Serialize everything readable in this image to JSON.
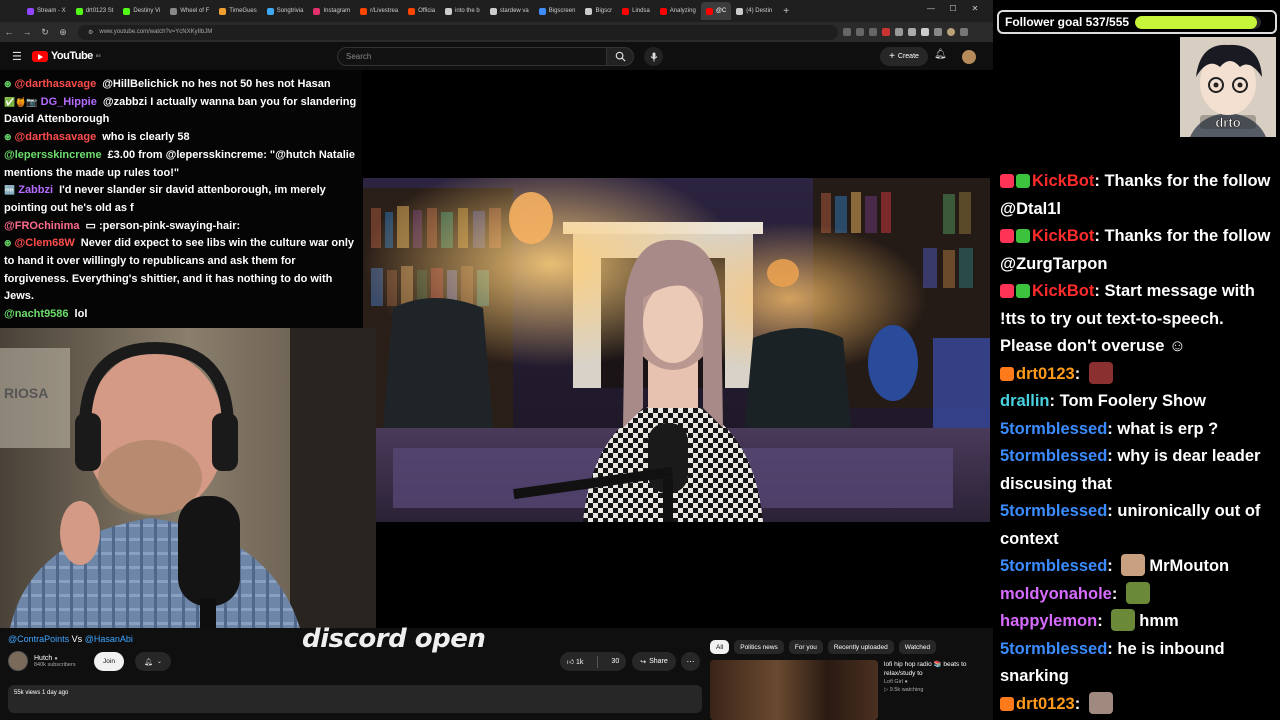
{
  "browser": {
    "tabs": [
      {
        "label": "Stream - X",
        "color": "#9146ff"
      },
      {
        "label": "drt0123 St",
        "color": "#53fc18"
      },
      {
        "label": "Destiny Vi",
        "color": "#53fc18"
      },
      {
        "label": "Wheel of F",
        "color": "#888888"
      },
      {
        "label": "TimeGues",
        "color": "#f0a030"
      },
      {
        "label": "Songtrivia",
        "color": "#3fa9f5"
      },
      {
        "label": "Instagram",
        "color": "#e1306c"
      },
      {
        "label": "r/Livestrea",
        "color": "#ff4500"
      },
      {
        "label": "Officia",
        "color": "#ff4500"
      },
      {
        "label": "into the b",
        "color": "#cccccc"
      },
      {
        "label": "stardew va",
        "color": "#cccccc"
      },
      {
        "label": "Bigscreen",
        "color": "#3f8cff"
      },
      {
        "label": "Bigscr",
        "color": "#cccccc"
      },
      {
        "label": "Lindsa",
        "color": "#ff0000"
      },
      {
        "label": "Analyzing",
        "color": "#ff0000"
      },
      {
        "label": "@C",
        "color": "#ff0000",
        "active": true
      },
      {
        "label": "(4) Destin",
        "color": "#cccccc"
      }
    ],
    "url": "www.youtube.com/watch?v=YcNXKyIIbJM"
  },
  "youtube": {
    "logo_text": "YouTube",
    "logo_sup": "BE",
    "search_placeholder": "Search",
    "create_label": "Create"
  },
  "left_chat": [
    {
      "user": "@darthasavage",
      "color": "#ff4d4d",
      "badges": "⊛",
      "text": "@HillBelichick no hes not 50 hes not Hasan"
    },
    {
      "user": "DG_Hippie",
      "color": "#b56bff",
      "badges": "✅🍯📷",
      "text": "@zabbzi I actually wanna ban you for slandering David Attenborough"
    },
    {
      "user": "@darthasavage",
      "color": "#ff4d4d",
      "badges": "⊛",
      "text": "who is clearly 58"
    },
    {
      "user": "@lepersskincreme",
      "color": "#6dde6d",
      "badges": "",
      "text": "£3.00 from @lepersskincreme: \"@hutch Natalie mentions the made up rules too!\""
    },
    {
      "user": "Zabbzi",
      "color": "#b56bff",
      "badges": "🆓",
      "text": "I'd never slander sir david attenborough, im merely pointing out he's old as f"
    },
    {
      "user": "@FROchinima",
      "color": "#ff6b8b",
      "badges": "",
      "text": "▭ :person-pink-swaying-hair:"
    },
    {
      "user": "@Clem68W",
      "color": "#ff4d4d",
      "badges": "⊛",
      "text": "Never did expect to see libs win the culture war only to hand it over willingly to republicans and ask them for forgiveness. Everything's shittier, and it has nothing to do with Jews."
    },
    {
      "user": "@nacht9586",
      "color": "#6dde6d",
      "badges": "",
      "text": "lol"
    }
  ],
  "video": {
    "title_prefix": "@ContraPoints",
    "title_mid": " Vs ",
    "title_suffix": "@HasanAbi",
    "caption": "discord open",
    "channel_name": "Hutch",
    "subscribers": "840k subscribers",
    "join_label": "Join",
    "likes": "1k",
    "dislikes": "30",
    "share_label": "Share",
    "views_line": "55k views  1 day ago"
  },
  "sidebar": {
    "chips": [
      "All",
      "Politics news",
      "For you",
      "Recently uploaded",
      "Watched"
    ],
    "rec_title": "lofi hip hop radio 📚 beats to relax/study to",
    "rec_channel": "Lofi Girl",
    "rec_status": "9.5k watching"
  },
  "overlay": {
    "goal_label": "Follower goal 537/555",
    "goal_fraction": 0.9676,
    "avatar_text": "drto"
  },
  "right_chat": [
    {
      "badges": [
        "#ff3355",
        "#3cc23c"
      ],
      "user": "KickBot",
      "color": "#ff2b2b",
      "text": "Thanks for the follow @Dtal1l"
    },
    {
      "badges": [
        "#ff3355",
        "#3cc23c"
      ],
      "user": "KickBot",
      "color": "#ff2b2b",
      "text": "Thanks for the follow @ZurgTarpon"
    },
    {
      "badges": [
        "#ff3355",
        "#3cc23c"
      ],
      "user": "KickBot",
      "color": "#ff2b2b",
      "text": "Start message with !tts to try out text-to-speech. Please don't overuse ☺"
    },
    {
      "badges": [
        "#ff7a1a"
      ],
      "user": "drt0123",
      "color": "#ff9a1a",
      "text": "",
      "emote": "#8a3030"
    },
    {
      "badges": [],
      "user": "drallin",
      "color": "#49d1e0",
      "text": "Tom Foolery Show"
    },
    {
      "badges": [],
      "user": "5tormblessed",
      "color": "#3b8cff",
      "text": "what is erp ?"
    },
    {
      "badges": [],
      "user": "5tormblessed",
      "color": "#3b8cff",
      "text": "why is dear leader discusing that"
    },
    {
      "badges": [],
      "user": "5tormblessed",
      "color": "#3b8cff",
      "text": "unironically out of context"
    },
    {
      "badges": [],
      "user": "5tormblessed",
      "color": "#3b8cff",
      "text": "MrMouton",
      "emote": "#c8a080",
      "emote_first": true
    },
    {
      "badges": [],
      "user": "moldyonahole",
      "color": "#d86bff",
      "text": "",
      "emote": "#6a8a3a"
    },
    {
      "badges": [],
      "user": "happylemon",
      "color": "#d86bff",
      "text": "hmm",
      "emote": "#6a8a3a",
      "emote_first": true
    },
    {
      "badges": [],
      "user": "5tormblessed",
      "color": "#3b8cff",
      "text": "he is inbound snarking"
    },
    {
      "badges": [
        "#ff7a1a"
      ],
      "user": "drt0123",
      "color": "#ff9a1a",
      "text": "",
      "emote": "#a08a80"
    }
  ]
}
